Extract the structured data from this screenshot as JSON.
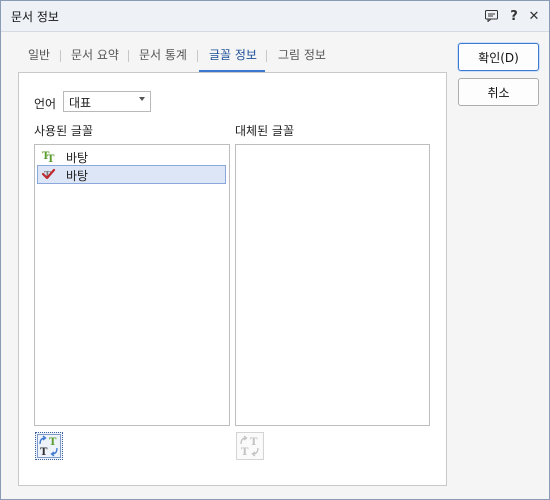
{
  "window": {
    "title": "문서 정보"
  },
  "titlebar_icons": [
    "comment-icon",
    "help-icon",
    "close-icon"
  ],
  "titlebar_glyphs": {
    "help": "?",
    "close": "✕"
  },
  "tabs": [
    {
      "label": "일반",
      "active": false
    },
    {
      "label": "문서 요약",
      "active": false
    },
    {
      "label": "문서 통계",
      "active": false
    },
    {
      "label": "글꼴 정보",
      "active": true
    },
    {
      "label": "그림 정보",
      "active": false
    }
  ],
  "buttons": {
    "ok": "확인(D)",
    "cancel": "취소"
  },
  "language": {
    "label": "언어",
    "selected": "대표"
  },
  "used_fonts": {
    "label": "사용된 글꼴",
    "items": [
      {
        "name": "바탕",
        "icon": "truetype-font-icon",
        "selected": false
      },
      {
        "name": "바탕",
        "icon": "embedded-font-check-icon",
        "selected": true
      }
    ]
  },
  "replaced_fonts": {
    "label": "대체된 글꼴",
    "items": []
  },
  "colors": {
    "accent": "#3b78d0",
    "selection": "#dde6f6",
    "font_icon_green": "#5a9c2e",
    "check_red": "#c0282d"
  }
}
